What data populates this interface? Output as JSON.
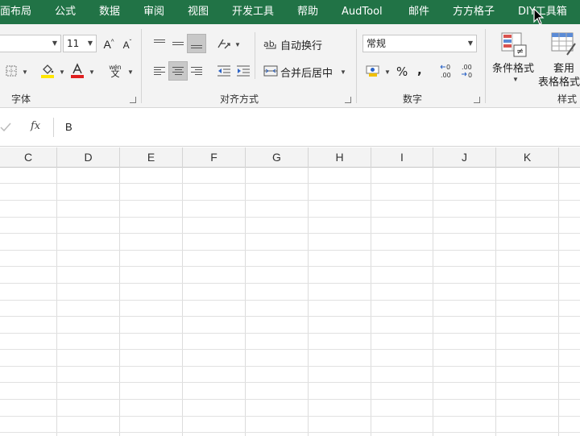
{
  "menu": {
    "tabs": [
      "面布局",
      "公式",
      "数据",
      "审阅",
      "视图",
      "开发工具",
      "帮助",
      "AudTool",
      "邮件",
      "方方格子",
      "DIY工具箱"
    ]
  },
  "ribbon": {
    "font": {
      "size": "11",
      "grow_glyph": "A",
      "shrink_glyph": "A",
      "color_glyph": "A",
      "phonetic_top": "wén",
      "phonetic_bottom": "文",
      "group_label": "字体"
    },
    "alignment": {
      "wrap_text": "自动换行",
      "merge_center": "合并后居中",
      "group_label": "对齐方式"
    },
    "number": {
      "format": "常规",
      "currency_glyph": "$",
      "percent": "%",
      "comma": ",",
      "inc_decimal": "←0\n.00",
      "dec_decimal": ".00\n→0",
      "group_label": "数字"
    },
    "styles": {
      "conditional_format": "条件格式",
      "format_table_line1": "套用",
      "format_table_line2": "表格格式",
      "group_label": "样式"
    }
  },
  "formula_bar": {
    "fx": "fx",
    "value": "B"
  },
  "grid": {
    "columns": [
      "C",
      "D",
      "E",
      "F",
      "G",
      "H",
      "I",
      "J",
      "K"
    ]
  },
  "colors": {
    "menu_bg": "#217346",
    "ribbon_bg": "#f3f3f3",
    "font_color_bar": "#e02020",
    "fill_color_bar": "#ffe600",
    "pressed_bg": "#c8c8c8"
  }
}
